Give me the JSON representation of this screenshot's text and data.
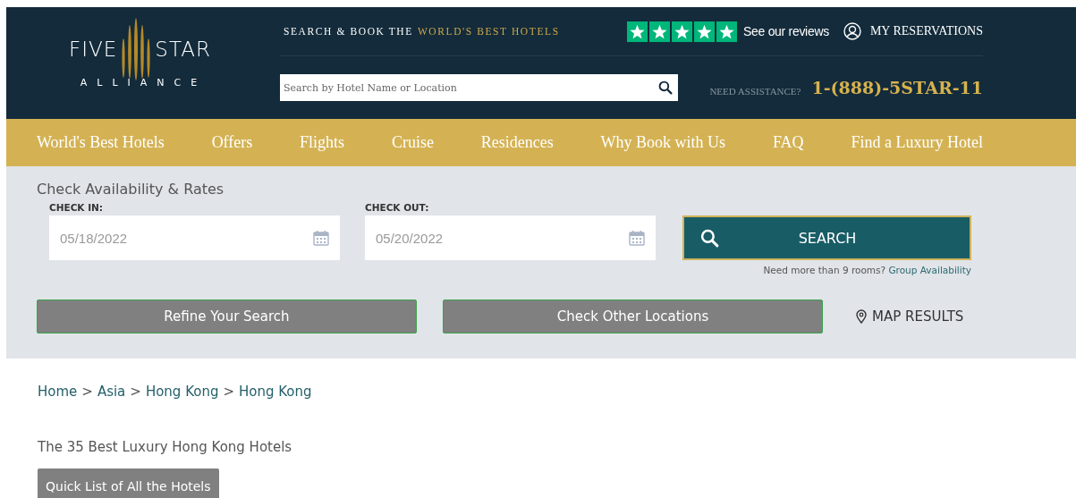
{
  "header": {
    "logo": {
      "word_1": "FIVE",
      "word_2": "STAR",
      "subtitle": "ALLIANCE"
    },
    "tagline": {
      "lead": "SEARCH & BOOK THE",
      "highlight": "WORLD'S BEST HOTELS"
    },
    "rating": {
      "stars": 5,
      "label": "See our reviews"
    },
    "account_link": "MY RESERVATIONS",
    "search": {
      "placeholder": "Search by Hotel Name or Location"
    },
    "assistance": {
      "label": "NEED ASSISTANCE?",
      "phone": "1-(888)-5STAR-11"
    }
  },
  "nav": {
    "items": [
      "World's Best Hotels",
      "Offers",
      "Flights",
      "Cruise",
      "Residences",
      "Why Book with Us",
      "FAQ",
      "Find a Luxury Hotel"
    ]
  },
  "availability": {
    "title": "Check Availability & Rates",
    "fields": [
      {
        "label": "CHECK IN:",
        "value": "05/18/2022"
      },
      {
        "label": "CHECK OUT:",
        "value": "05/20/2022"
      }
    ],
    "search_button": "SEARCH",
    "group_note": {
      "text": "Need more than 9 rooms?",
      "link": "Group Availability"
    },
    "actions": [
      {
        "kind": "button",
        "label": "Refine Your Search"
      },
      {
        "kind": "button",
        "label": "Check Other Locations"
      },
      {
        "kind": "map",
        "label": "MAP RESULTS"
      }
    ]
  },
  "breadcrumb": {
    "separator": ">",
    "items": [
      "Home",
      "Asia",
      "Hong Kong",
      "Hong Kong"
    ]
  },
  "heading": "The 35 Best Luxury Hong Kong Hotels",
  "quick_list_button": "Quick List of All the Hotels"
}
